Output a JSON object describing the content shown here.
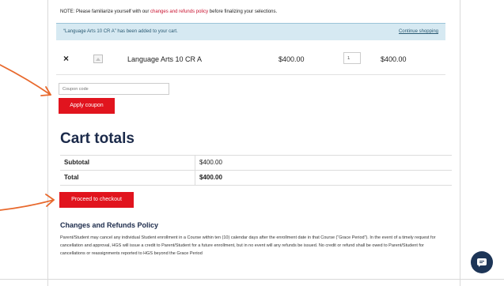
{
  "notice": {
    "prefix": "NOTE: Please familiarize yourself with our",
    "link": "changes and refunds policy",
    "suffix": "before finalizing your selections."
  },
  "message": {
    "text": "“Language Arts 10 CR A” has been added to your cart.",
    "link": "Continue shopping"
  },
  "cart_item": {
    "remove_icon": "×",
    "thumbnail_icon": "image-placeholder-icon",
    "name": "Language Arts 10 CR A",
    "price": "$400.00",
    "quantity": "1",
    "subtotal": "$400.00"
  },
  "coupon": {
    "placeholder": "Coupon code",
    "button_label": "Apply coupon"
  },
  "cart_totals": {
    "heading": "Cart totals",
    "rows": [
      {
        "label": "Subtotal",
        "value": "$400.00"
      },
      {
        "label": "Total",
        "value": "$400.00"
      }
    ]
  },
  "checkout": {
    "button_label": "Proceed to checkout"
  },
  "policy": {
    "heading": "Changes and Refunds Policy",
    "text": "Parent/Student may cancel any individual Student enrollment in a Course within ten (10) calendar days after the enrollment date in that Course (“Grace Period”). In the event of a timely request for cancellation and approval, HGS will issue a credit to Parent/Student for a future enrollment, but in no event will any refunds be issued. No credit or refund shall be owed to Parent/Student for cancellations or reassignments reported to HGS beyond the Grace Period"
  },
  "chat": {
    "icon": "chat-icon"
  },
  "colors": {
    "accent_red": "#e1141e",
    "heading_navy": "#1b2a4a",
    "info_bg": "#d6e9f2",
    "annotation_orange": "#e8692d"
  }
}
